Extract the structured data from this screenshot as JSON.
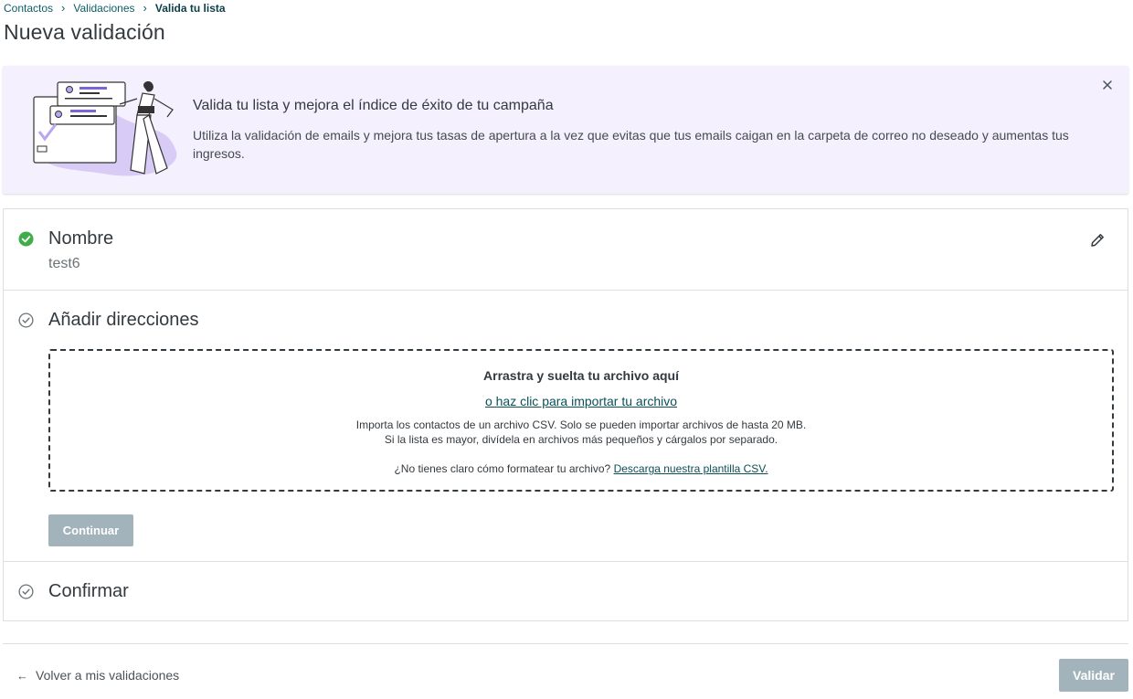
{
  "breadcrumb": {
    "items": [
      "Contactos",
      "Validaciones",
      "Valida tu lista"
    ]
  },
  "page": {
    "title": "Nueva validación"
  },
  "banner": {
    "title": "Valida tu lista y mejora el índice de éxito de tu campaña",
    "text": "Utiliza la validación de emails y mejora tus tasas de apertura a la vez que evitas que tus emails caigan en la carpeta de correo no deseado y aumentas tus ingresos.",
    "close_icon": "close-icon"
  },
  "steps": {
    "name": {
      "title": "Nombre",
      "value": "test6",
      "status": "completed",
      "edit_icon": "pencil-icon"
    },
    "addresses": {
      "title": "Añadir direcciones",
      "status": "pending",
      "dropzone": {
        "title": "Arrastra y suelta tu archivo aquí",
        "link": "o haz clic para importar tu archivo",
        "info_line1": "Importa los contactos de un archivo CSV. Solo se pueden importar archivos de hasta 20 MB.",
        "info_line2": "Si la lista es mayor, divídela en archivos más pequeños y cárgalos por separado.",
        "help_text": "¿No tienes claro cómo formatear tu archivo?",
        "help_link": "Descarga nuestra plantilla CSV."
      },
      "continue_label": "Continuar"
    },
    "confirm": {
      "title": "Confirmar",
      "status": "pending"
    }
  },
  "footer": {
    "back_label": "Volver a mis validaciones",
    "validate_label": "Validar"
  },
  "colors": {
    "banner_bg": "#f4f0fd",
    "success": "#3fae49",
    "link": "#0b4f57",
    "disabled_button": "#a2b3bb"
  }
}
